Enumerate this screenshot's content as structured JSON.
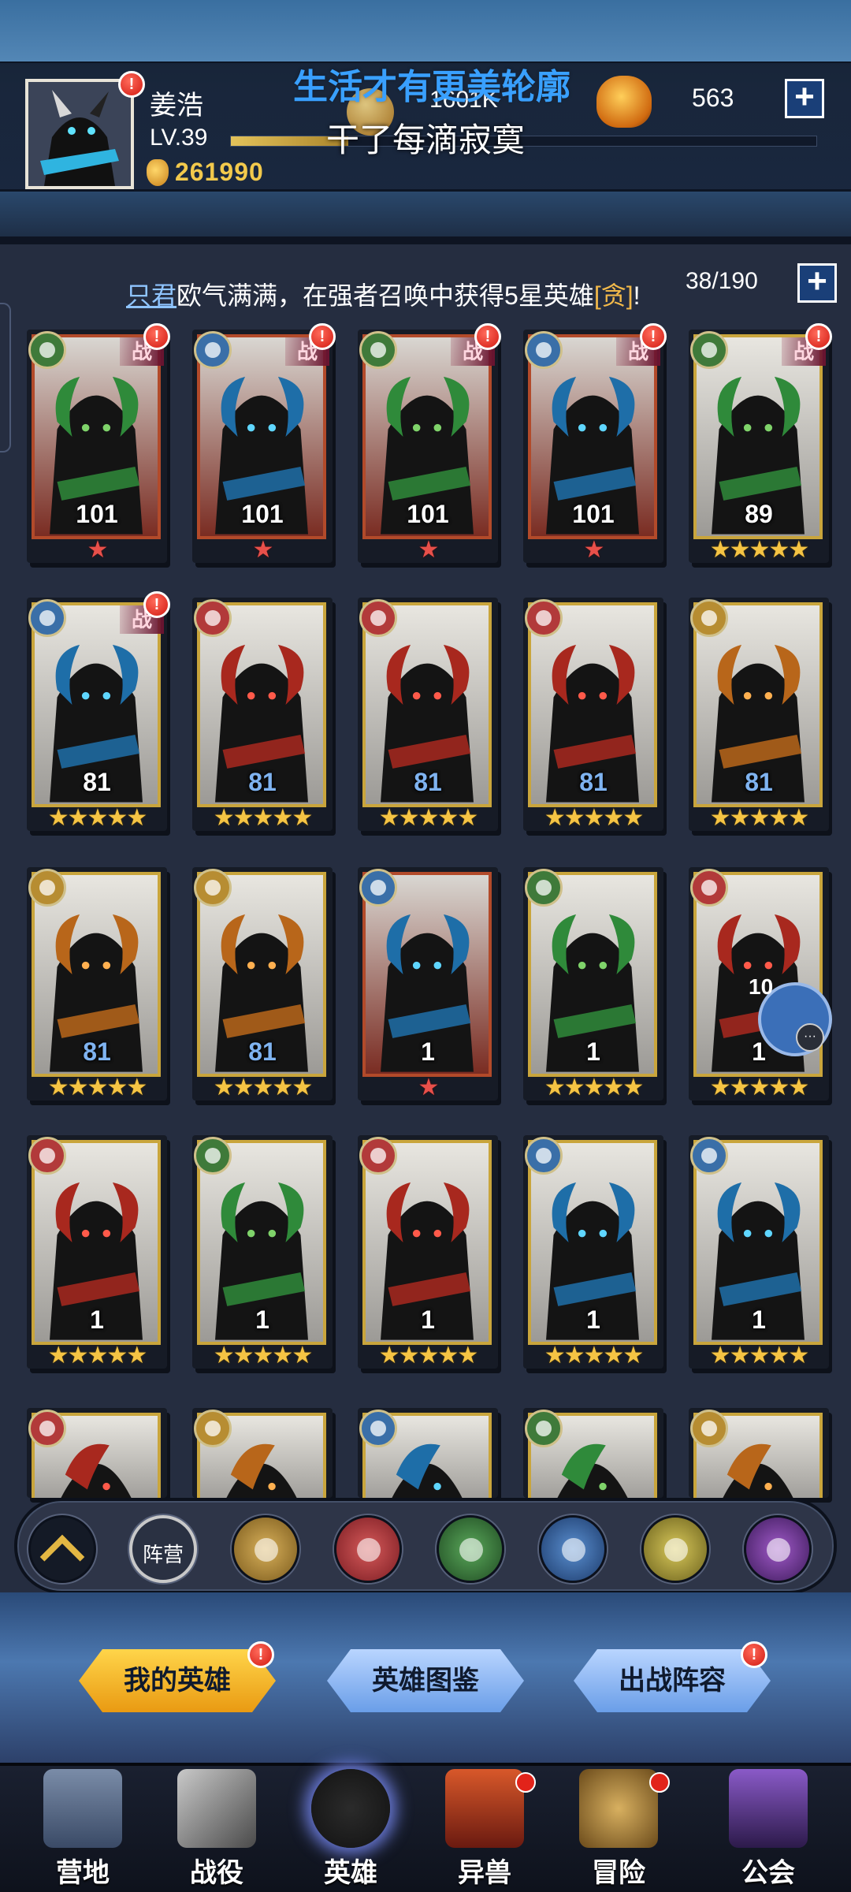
{
  "player": {
    "name": "姜浩",
    "level_label": "LV.39",
    "gold": "261990",
    "power": "1601K",
    "exp_fraction": 0.2
  },
  "overlay": {
    "line1": "生活才有更美轮廓",
    "line2": "干了每滴寂寞"
  },
  "resource": {
    "value": "563"
  },
  "ticker": {
    "player_name": "只君",
    "message": "欧气满满，在强者召唤中获得5星英雄",
    "hero_name": "[贪]",
    "suffix": "!"
  },
  "hero_count": "38/190",
  "heroes": [
    {
      "element": "nature",
      "level": "101",
      "stars": 1,
      "star_type": "red",
      "battle": true,
      "alert": true,
      "frame": "red"
    },
    {
      "element": "water",
      "level": "101",
      "stars": 1,
      "star_type": "red",
      "battle": true,
      "alert": true,
      "frame": "red"
    },
    {
      "element": "nature",
      "level": "101",
      "stars": 1,
      "star_type": "red",
      "battle": true,
      "alert": true,
      "frame": "red"
    },
    {
      "element": "water",
      "level": "101",
      "stars": 1,
      "star_type": "red",
      "battle": true,
      "alert": true,
      "frame": "red"
    },
    {
      "element": "nature",
      "level": "89",
      "stars": 5,
      "star_type": "gold",
      "battle": true,
      "alert": true,
      "frame": "gold"
    },
    {
      "element": "water",
      "level": "81",
      "stars": 5,
      "star_type": "gold",
      "battle": true,
      "alert": true,
      "frame": "gold"
    },
    {
      "element": "fire",
      "level": "81",
      "stars": 5,
      "star_type": "gold",
      "battle": false,
      "alert": false,
      "frame": "gold",
      "blue_level": true
    },
    {
      "element": "fire",
      "level": "81",
      "stars": 5,
      "star_type": "gold",
      "battle": false,
      "alert": false,
      "frame": "gold",
      "blue_level": true
    },
    {
      "element": "fire",
      "level": "81",
      "stars": 5,
      "star_type": "gold",
      "battle": false,
      "alert": false,
      "frame": "gold",
      "blue_level": true
    },
    {
      "element": "light",
      "level": "81",
      "stars": 5,
      "star_type": "gold",
      "battle": false,
      "alert": false,
      "frame": "gold",
      "blue_level": true
    },
    {
      "element": "light",
      "level": "81",
      "stars": 5,
      "star_type": "gold",
      "battle": false,
      "alert": false,
      "frame": "gold",
      "blue_level": true
    },
    {
      "element": "light",
      "level": "81",
      "stars": 5,
      "star_type": "gold",
      "battle": false,
      "alert": false,
      "frame": "gold",
      "blue_level": true
    },
    {
      "element": "water",
      "level": "1",
      "stars": 1,
      "star_type": "red",
      "battle": false,
      "alert": false,
      "frame": "red"
    },
    {
      "element": "nature",
      "level": "1",
      "stars": 5,
      "star_type": "gold",
      "battle": false,
      "alert": false,
      "frame": "gold"
    },
    {
      "element": "fire",
      "level": "1",
      "stars": 5,
      "star_type": "gold",
      "battle": false,
      "alert": false,
      "frame": "gold"
    },
    {
      "element": "fire",
      "level": "1",
      "stars": 5,
      "star_type": "gold",
      "battle": false,
      "alert": false,
      "frame": "gold"
    },
    {
      "element": "nature",
      "level": "1",
      "stars": 5,
      "star_type": "gold",
      "battle": false,
      "alert": false,
      "frame": "gold"
    },
    {
      "element": "fire",
      "level": "1",
      "stars": 5,
      "star_type": "gold",
      "battle": false,
      "alert": false,
      "frame": "gold"
    },
    {
      "element": "water",
      "level": "1",
      "stars": 5,
      "star_type": "gold",
      "battle": false,
      "alert": false,
      "frame": "gold"
    },
    {
      "element": "water",
      "level": "1",
      "stars": 5,
      "star_type": "gold",
      "battle": false,
      "alert": false,
      "frame": "gold"
    }
  ],
  "partial_row": [
    "fire",
    "light",
    "water",
    "nature",
    "light"
  ],
  "chat": {
    "count": "10",
    "icon": "chat-bubble-icon"
  },
  "filter": {
    "faction_label": "阵营",
    "elements": [
      "light",
      "fire",
      "nature",
      "water",
      "holy",
      "dark"
    ]
  },
  "tabs": [
    {
      "label": "我的英雄",
      "active": true,
      "alert": true
    },
    {
      "label": "英雄图鉴",
      "active": false,
      "alert": false
    },
    {
      "label": "出战阵容",
      "active": false,
      "alert": true
    }
  ],
  "nav": [
    {
      "label": "营地",
      "icon": "camp-icon",
      "active": false,
      "dot": false
    },
    {
      "label": "战役",
      "icon": "battle-icon",
      "active": false,
      "dot": false
    },
    {
      "label": "英雄",
      "icon": "hero-icon",
      "active": true,
      "dot": false
    },
    {
      "label": "异兽",
      "icon": "beast-icon",
      "active": false,
      "dot": true
    },
    {
      "label": "冒险",
      "icon": "adventure-icon",
      "active": false,
      "dot": true
    },
    {
      "label": "公会",
      "icon": "guild-icon",
      "active": false,
      "dot": false
    }
  ],
  "badges": {
    "alert_mark": "!",
    "battle_tag": "战",
    "star_glyph": "★",
    "plus_glyph": "+",
    "chat_dots": "···"
  },
  "colors": {
    "gold_star": "#f5c444",
    "red_star": "#e8504a",
    "active_tab": "#f0b020",
    "tab": "#7aa7ec"
  }
}
